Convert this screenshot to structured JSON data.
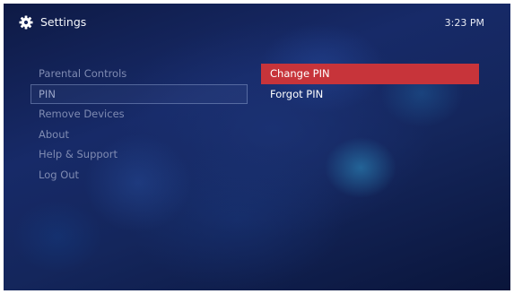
{
  "header": {
    "title": "Settings",
    "time": "3:23 PM",
    "icon": "gear-icon"
  },
  "left_menu": {
    "items": [
      {
        "label": "Parental Controls",
        "selected": false
      },
      {
        "label": "PIN",
        "selected": true
      },
      {
        "label": "Remove Devices",
        "selected": false
      },
      {
        "label": "About",
        "selected": false
      },
      {
        "label": "Help & Support",
        "selected": false
      },
      {
        "label": "Log Out",
        "selected": false
      }
    ]
  },
  "right_menu": {
    "items": [
      {
        "label": "Change PIN",
        "active": true
      },
      {
        "label": "Forgot PIN",
        "active": false
      }
    ]
  },
  "colors": {
    "accent": "#c7343a",
    "background": "#172a68",
    "menu_text": "#7f8bb2"
  }
}
